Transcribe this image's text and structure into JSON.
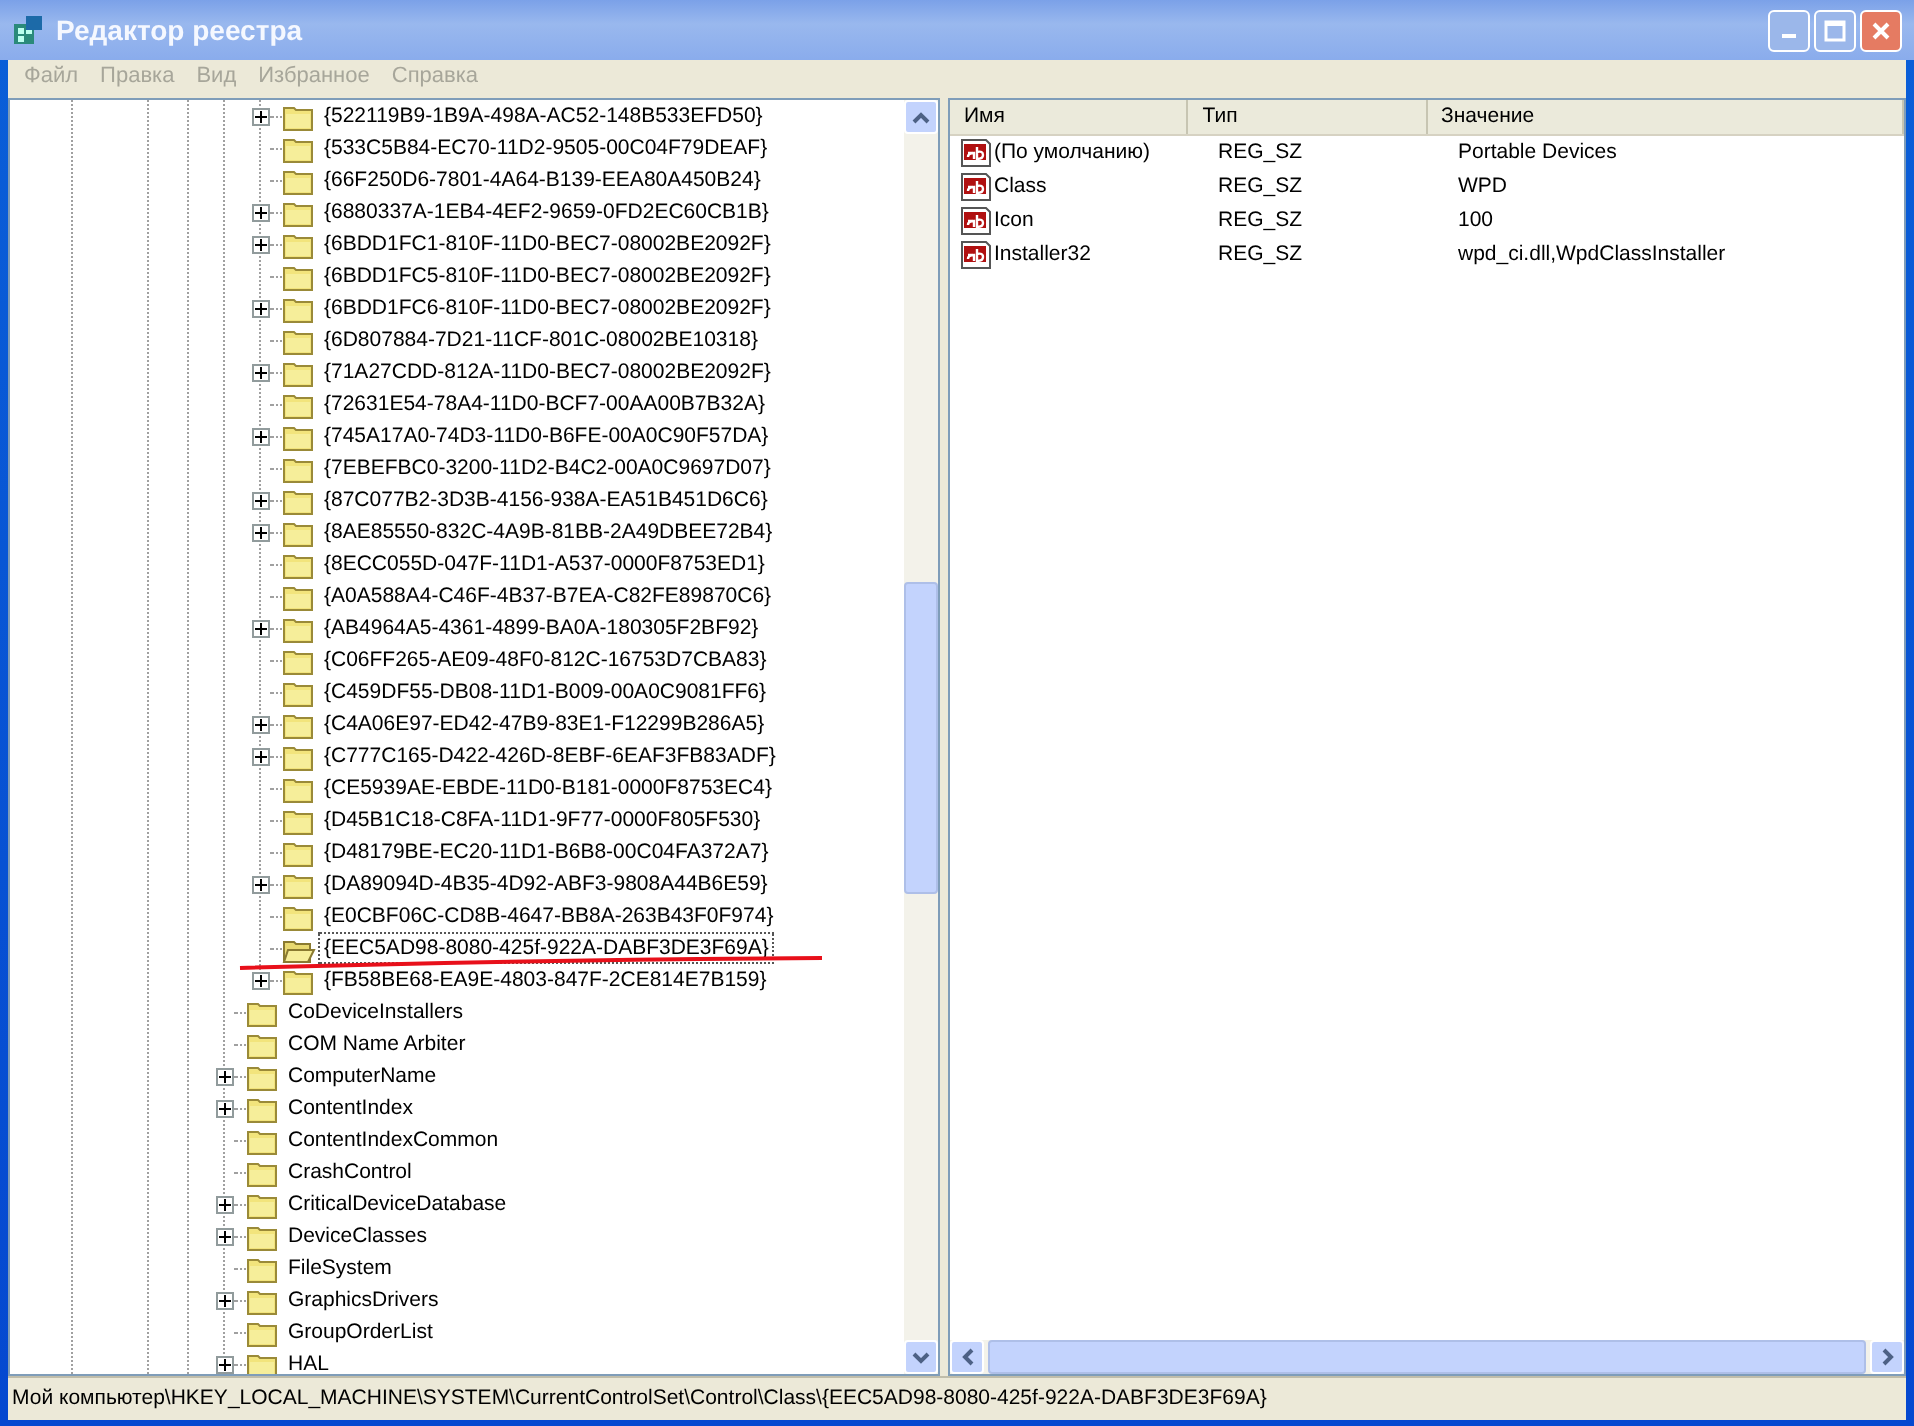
{
  "window": {
    "title": "Редактор реестра"
  },
  "menu": [
    "Файл",
    "Правка",
    "Вид",
    "Избранное",
    "Справка"
  ],
  "tree": {
    "nested_items": [
      {
        "label": "{522119B9-1B9A-498A-AC52-148B533EFD50}",
        "expandable": true,
        "selected": false
      },
      {
        "label": "{533C5B84-EC70-11D2-9505-00C04F79DEAF}",
        "expandable": false,
        "selected": false
      },
      {
        "label": "{66F250D6-7801-4A64-B139-EEA80A450B24}",
        "expandable": false,
        "selected": false
      },
      {
        "label": "{6880337A-1EB4-4EF2-9659-0FD2EC60CB1B}",
        "expandable": true,
        "selected": false
      },
      {
        "label": "{6BDD1FC1-810F-11D0-BEC7-08002BE2092F}",
        "expandable": true,
        "selected": false
      },
      {
        "label": "{6BDD1FC5-810F-11D0-BEC7-08002BE2092F}",
        "expandable": false,
        "selected": false
      },
      {
        "label": "{6BDD1FC6-810F-11D0-BEC7-08002BE2092F}",
        "expandable": true,
        "selected": false
      },
      {
        "label": "{6D807884-7D21-11CF-801C-08002BE10318}",
        "expandable": false,
        "selected": false
      },
      {
        "label": "{71A27CDD-812A-11D0-BEC7-08002BE2092F}",
        "expandable": true,
        "selected": false
      },
      {
        "label": "{72631E54-78A4-11D0-BCF7-00AA00B7B32A}",
        "expandable": false,
        "selected": false
      },
      {
        "label": "{745A17A0-74D3-11D0-B6FE-00A0C90F57DA}",
        "expandable": true,
        "selected": false
      },
      {
        "label": "{7EBEFBC0-3200-11D2-B4C2-00A0C9697D07}",
        "expandable": false,
        "selected": false
      },
      {
        "label": "{87C077B2-3D3B-4156-938A-EA51B451D6C6}",
        "expandable": true,
        "selected": false
      },
      {
        "label": "{8AE85550-832C-4A9B-81BB-2A49DBEE72B4}",
        "expandable": true,
        "selected": false
      },
      {
        "label": "{8ECC055D-047F-11D1-A537-0000F8753ED1}",
        "expandable": false,
        "selected": false
      },
      {
        "label": "{A0A588A4-C46F-4B37-B7EA-C82FE89870C6}",
        "expandable": false,
        "selected": false
      },
      {
        "label": "{AB4964A5-4361-4899-BA0A-180305F2BF92}",
        "expandable": true,
        "selected": false
      },
      {
        "label": "{C06FF265-AE09-48F0-812C-16753D7CBA83}",
        "expandable": false,
        "selected": false
      },
      {
        "label": "{C459DF55-DB08-11D1-B009-00A0C9081FF6}",
        "expandable": false,
        "selected": false
      },
      {
        "label": "{C4A06E97-ED42-47B9-83E1-F12299B286A5}",
        "expandable": true,
        "selected": false
      },
      {
        "label": "{C777C165-D422-426D-8EBF-6EAF3FB83ADF}",
        "expandable": true,
        "selected": false
      },
      {
        "label": "{CE5939AE-EBDE-11D0-B181-0000F8753EC4}",
        "expandable": false,
        "selected": false
      },
      {
        "label": "{D45B1C18-C8FA-11D1-9F77-0000F805F530}",
        "expandable": false,
        "selected": false
      },
      {
        "label": "{D48179BE-EC20-11D1-B6B8-00C04FA372A7}",
        "expandable": false,
        "selected": false
      },
      {
        "label": "{DA89094D-4B35-4D92-ABF3-9808A44B6E59}",
        "expandable": true,
        "selected": false
      },
      {
        "label": "{E0CBF06C-CD8B-4647-BB8A-263B43F0F974}",
        "expandable": false,
        "selected": false
      },
      {
        "label": "{EEC5AD98-8080-425f-922A-DABF3DE3F69A}",
        "expandable": false,
        "selected": true
      },
      {
        "label": "{FB58BE68-EA9E-4803-847F-2CE814E7B159}",
        "expandable": true,
        "selected": false
      }
    ],
    "items": [
      {
        "label": "CoDeviceInstallers",
        "expandable": false,
        "selected": false
      },
      {
        "label": "COM Name Arbiter",
        "expandable": false,
        "selected": false
      },
      {
        "label": "ComputerName",
        "expandable": true,
        "selected": false
      },
      {
        "label": "ContentIndex",
        "expandable": true,
        "selected": false
      },
      {
        "label": "ContentIndexCommon",
        "expandable": false,
        "selected": false
      },
      {
        "label": "CrashControl",
        "expandable": false,
        "selected": false
      },
      {
        "label": "CriticalDeviceDatabase",
        "expandable": true,
        "selected": false
      },
      {
        "label": "DeviceClasses",
        "expandable": true,
        "selected": false
      },
      {
        "label": "FileSystem",
        "expandable": false,
        "selected": false
      },
      {
        "label": "GraphicsDrivers",
        "expandable": true,
        "selected": false
      },
      {
        "label": "GroupOrderList",
        "expandable": false,
        "selected": false
      },
      {
        "label": "HAL",
        "expandable": true,
        "selected": false
      }
    ]
  },
  "values": {
    "columns": [
      "Имя",
      "Тип",
      "Значение"
    ],
    "rows": [
      {
        "name": "(По умолчанию)",
        "type": "REG_SZ",
        "data": "Portable Devices"
      },
      {
        "name": "Class",
        "type": "REG_SZ",
        "data": "WPD"
      },
      {
        "name": "Icon",
        "type": "REG_SZ",
        "data": "100"
      },
      {
        "name": "Installer32",
        "type": "REG_SZ",
        "data": "wpd_ci.dll,WpdClassInstaller"
      }
    ]
  },
  "status_bar": "Мой компьютер\\HKEY_LOCAL_MACHINE\\SYSTEM\\CurrentControlSet\\Control\\Class\\{EEC5AD98-8080-425f-922A-DABF3DE3F69A}"
}
